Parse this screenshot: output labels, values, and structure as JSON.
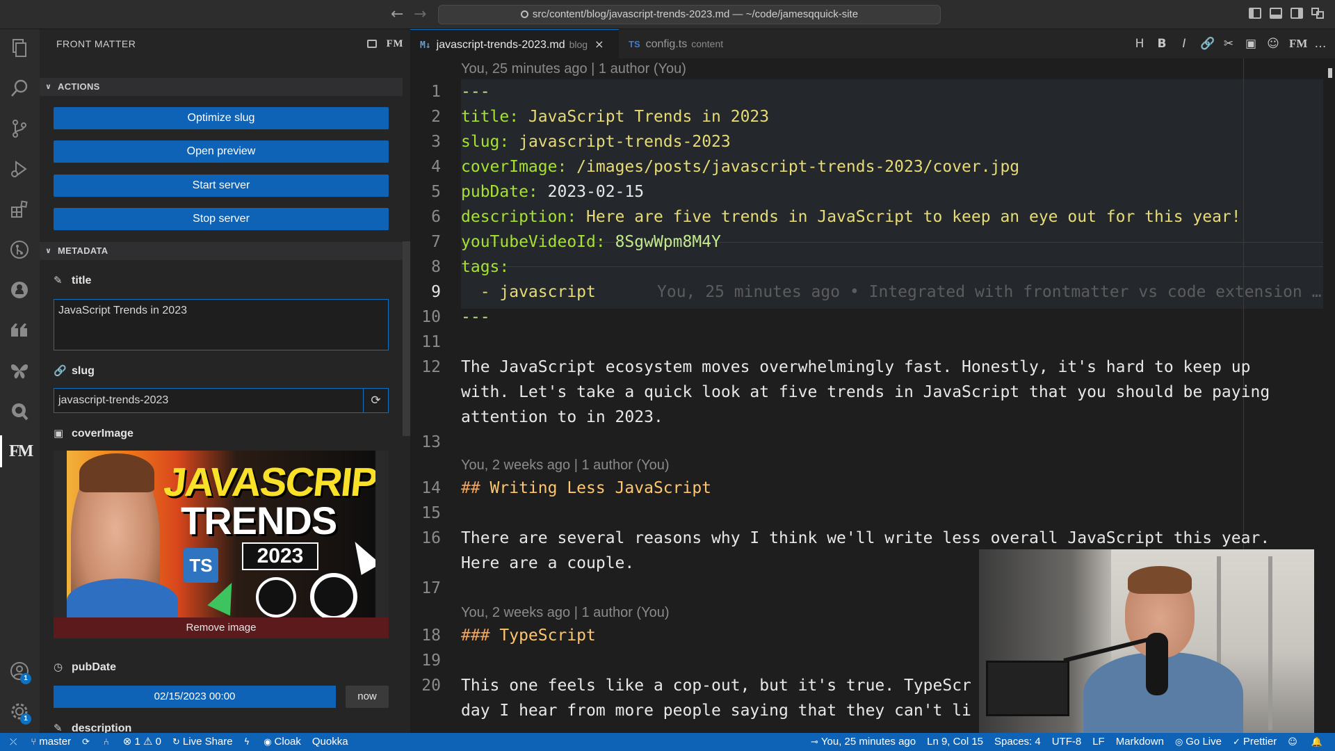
{
  "titlebar": {
    "command_center": "src/content/blog/javascript-trends-2023.md — ~/code/jamesqquick-site"
  },
  "activity_bar": {
    "accounts_badge": "1",
    "settings_badge": "1"
  },
  "sidebar": {
    "header": "FRONT MATTER",
    "header_fm": "FM",
    "actions": {
      "title": "ACTIONS",
      "buttons": [
        "Optimize slug",
        "Open preview",
        "Start server",
        "Stop server"
      ]
    },
    "metadata": {
      "title": "METADATA",
      "title_label": "title",
      "title_value": "JavaScript Trends in 2023",
      "slug_label": "slug",
      "slug_value": "javascript-trends-2023",
      "cover_label": "coverImage",
      "cover_art": {
        "line1": "JAVASCRIPT",
        "line2": "TRENDS",
        "year": "2023",
        "ts": "TS"
      },
      "remove_image": "Remove image",
      "pubdate_label": "pubDate",
      "pubdate_value": "02/15/2023 00:00",
      "now_button": "now",
      "description_label": "description"
    }
  },
  "editor": {
    "tabs": [
      {
        "icon": "M↓",
        "name": "javascript-trends-2023.md",
        "hint": "blog",
        "close": "×"
      },
      {
        "icon": "TS",
        "name": "config.ts",
        "hint": "content"
      }
    ],
    "toolbar": [
      "H",
      "B",
      "I",
      "🔗",
      "✂",
      "▣",
      "☺",
      "FM",
      "…"
    ],
    "lens": {
      "l1": "You, 25 minutes ago | 1 author (You)",
      "l14": "You, 2 weeks ago | 1 author (You)",
      "l18": "You, 2 weeks ago | 1 author (You)"
    },
    "lines": {
      "n1": "1",
      "n2": "2",
      "n3": "3",
      "n4": "4",
      "n5": "5",
      "n6": "6",
      "n7": "7",
      "n8": "8",
      "n9": "9",
      "n10": "10",
      "n11": "11",
      "n12": "12",
      "n13": "13",
      "n14": "14",
      "n15": "15",
      "n16": "16",
      "n17": "17",
      "n18": "18",
      "n19": "19",
      "n20": "20",
      "dashes": "---",
      "title_key": "title:",
      "title_val": " JavaScript Trends in 2023",
      "slug_key": "slug:",
      "slug_val": " javascript-trends-2023",
      "cover_key": "coverImage:",
      "cover_val": " /images/posts/javascript-trends-2023/cover.jpg",
      "pub_key": "pubDate:",
      "pub_val": " 2023-02-15",
      "desc_key": "description:",
      "desc_val": " Here are five trends in JavaScript to keep an eye out for this year!",
      "yt_key": "youTubeVideoId:",
      "yt_val": " 8SgwWpm8M4Y",
      "tags_key": "tags:",
      "tag_item": "  - javascript",
      "blame": "You, 25 minutes ago • Integrated with frontmatter vs code extension …",
      "p12a": "The JavaScript ecosystem moves overwhelmingly fast. Honestly, it's hard to keep up",
      "p12b": "with. Let's take a quick look at five trends in JavaScript that you should be paying",
      "p12c": "attention to in 2023.",
      "h14_hash": "## ",
      "h14_text": "Writing Less JavaScript",
      "p16a": "There are several reasons why I think we'll write less overall JavaScript this year.",
      "p16b": "Here are a couple.",
      "h18_hash": "### ",
      "h18_text": "TypeScript",
      "p20a": "This one feels like a cop-out, but it's true. TypeScr",
      "p20b": "day I hear from more people saying that they can't li"
    }
  },
  "statusbar": {
    "left": {
      "branch": "master",
      "problems": "⊗ 1 ⚠ 0",
      "liveshare": "Live Share",
      "cloak": "Cloak",
      "quokka": "Quokka"
    },
    "right": {
      "blame": "You, 25 minutes ago",
      "position": "Ln 9, Col 15",
      "spaces": "Spaces: 4",
      "encoding": "UTF-8",
      "eol": "LF",
      "language": "Markdown",
      "golive": "Go Live",
      "prettier": "Prettier"
    }
  }
}
